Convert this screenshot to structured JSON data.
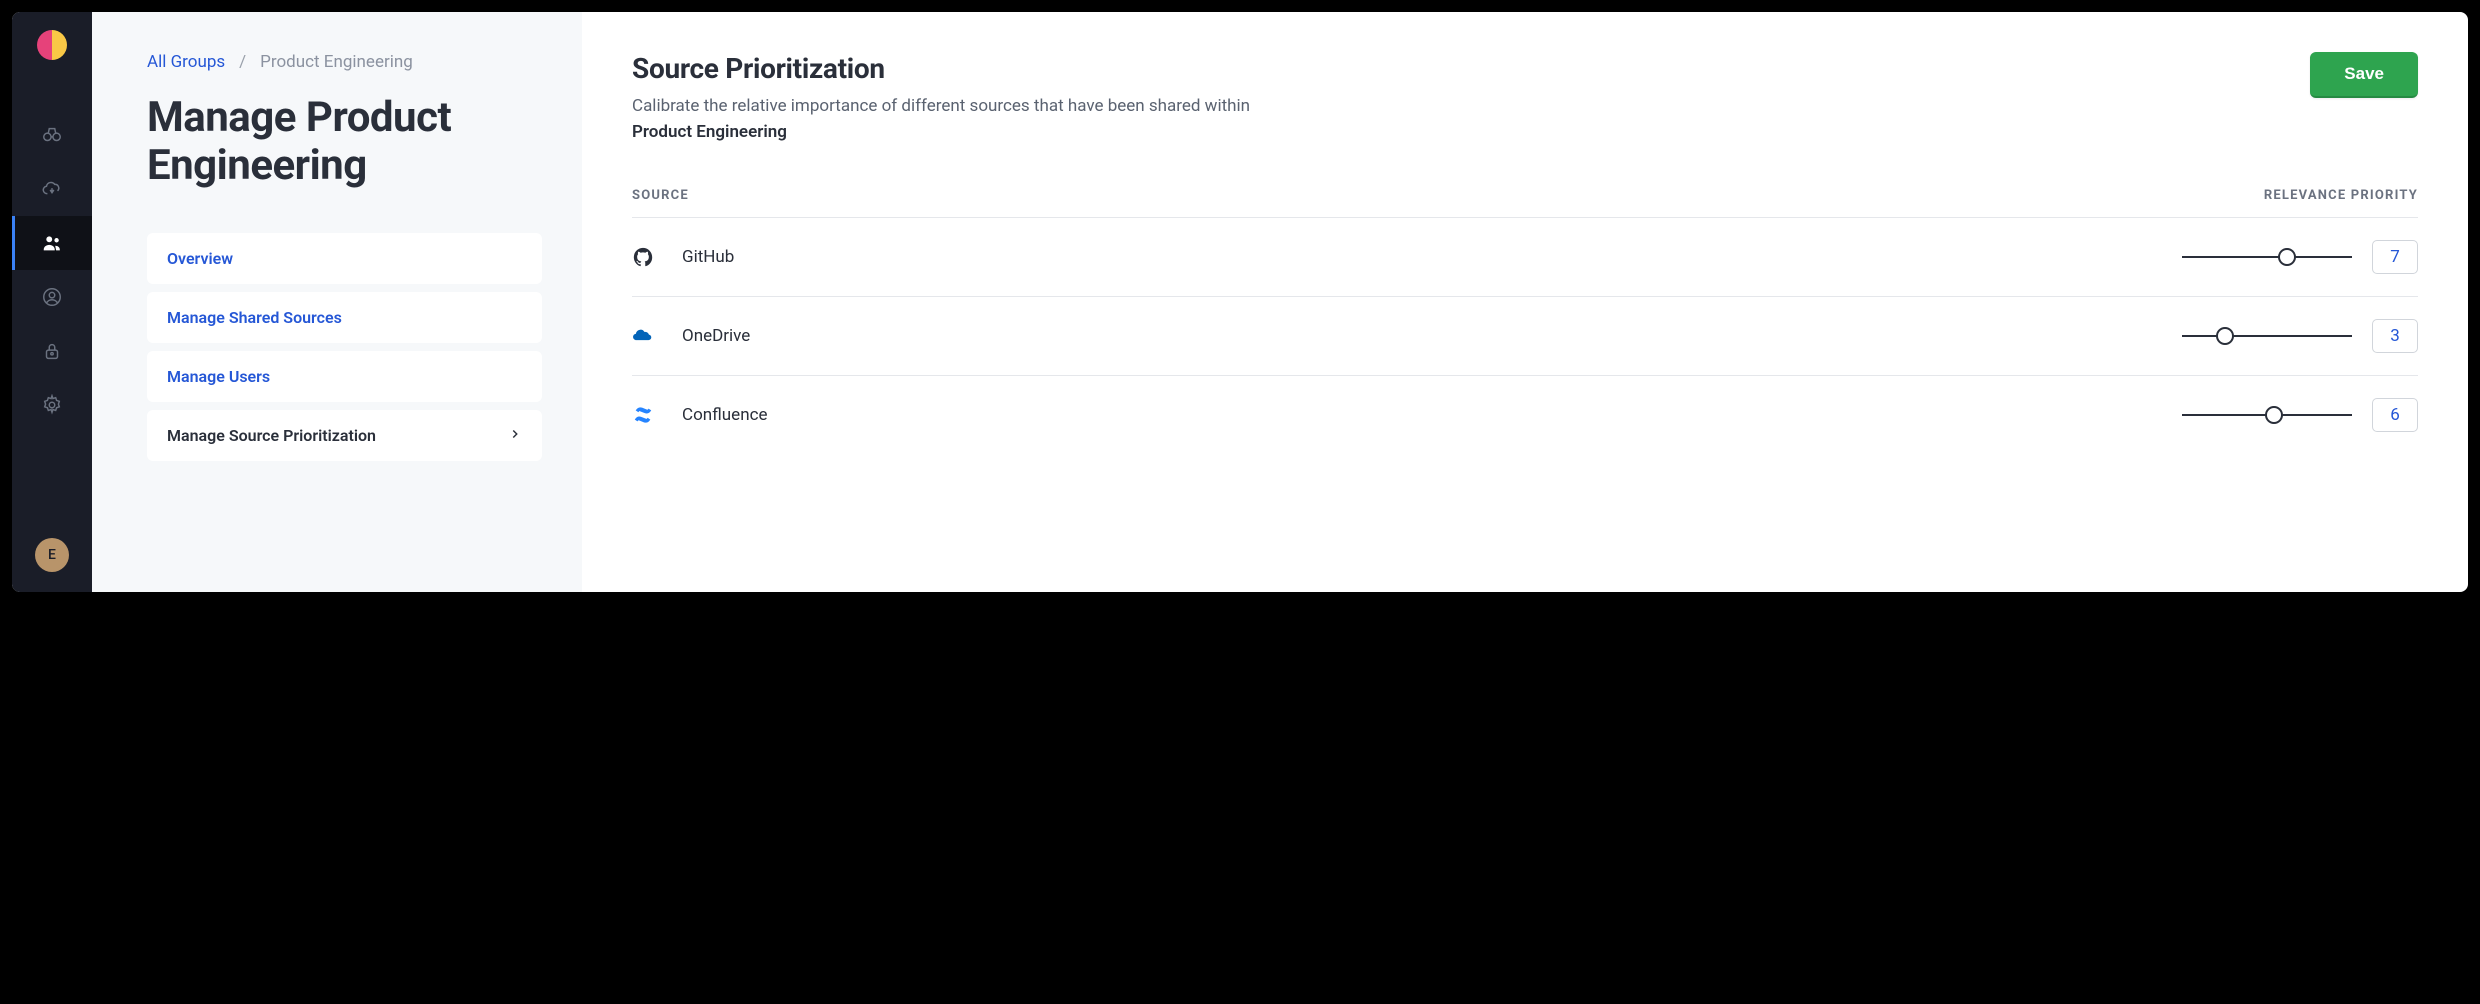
{
  "breadcrumb": {
    "parent": "All Groups",
    "current": "Product Engineering"
  },
  "page_title": "Manage Product Engineering",
  "local_nav": {
    "overview": "Overview",
    "shared_sources": "Manage Shared Sources",
    "users": "Manage Users",
    "prioritization": "Manage Source Prioritization"
  },
  "main": {
    "title": "Source Prioritization",
    "description_prefix": "Calibrate the relative importance of different sources that have been shared within ",
    "description_group": "Product Engineering",
    "save_label": "Save",
    "col_source": "SOURCE",
    "col_priority": "RELEVANCE PRIORITY",
    "sources": [
      {
        "name": "GitHub",
        "priority": 7,
        "slider_percent": 62
      },
      {
        "name": "OneDrive",
        "priority": 3,
        "slider_percent": 25
      },
      {
        "name": "Confluence",
        "priority": 6,
        "slider_percent": 54
      }
    ]
  },
  "avatar_initial": "E"
}
